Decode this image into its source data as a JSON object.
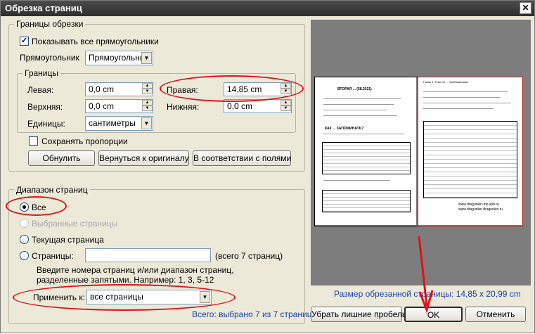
{
  "window": {
    "title": "Обрезка страниц",
    "close_glyph": "✕"
  },
  "crop_bounds": {
    "legend": "Границы обрезки",
    "show_all_rectangles": "Показывать все прямоугольники",
    "rectangle_label": "Прямоугольник",
    "rectangle_value": "Прямоугольник",
    "bounds_legend": "Границы",
    "left_label": "Левая:",
    "left_value": "0,0 cm",
    "right_label": "Правая:",
    "right_value": "14,85 cm",
    "top_label": "Верхняя:",
    "top_value": "0,0 cm",
    "bottom_label": "Нижняя:",
    "bottom_value": "0,0 cm",
    "units_label": "Единицы:",
    "units_value": "сантиметры",
    "keep_proportions": "Сохранять пропорции",
    "reset_button": "Обнулить",
    "revert_button": "Вернуться к оригиналу",
    "fit_margins_button": "В соответствии с полями"
  },
  "page_range": {
    "legend": "Диапазон страниц",
    "all": "Все",
    "selected": "Выбранные страницы",
    "current": "Текущая страница",
    "pages": "Страницы:",
    "pages_value": "",
    "total": "(всего 7 страниц)",
    "hint": "Введите номера страниц и/или диапазон страниц, разделенные запятыми. Например: 1, 3, 5-12",
    "apply_to_label": "Применить к:",
    "apply_to_value": "все страницы",
    "selection_summary": "Всего: выбрано 7 из 7 страниц"
  },
  "preview": {
    "size_text": "Размер обрезанной страницы: 14,85 x 20,99 cm",
    "left_page_heading": "ВТОРАЯ ... (58.2021)",
    "left_page_question": "КАК ... ЗАПОМИНАТЬ?",
    "right_page_title": "Глава 3. Тема 11 ... приближенные",
    "right_page_url1": "www.dragunkin-mp.spb.ru",
    "right_page_url2": "www.dragunkin.dragunkin.ru"
  },
  "footer": {
    "remove_spaces_button": "Убрать лишние пробелы",
    "ok_button": "OK",
    "cancel_button": "Отменить"
  },
  "colors": {
    "annotation": "#e0101a",
    "blue_text": "#1a3fa8",
    "title_bar": "#3a3a3a"
  }
}
